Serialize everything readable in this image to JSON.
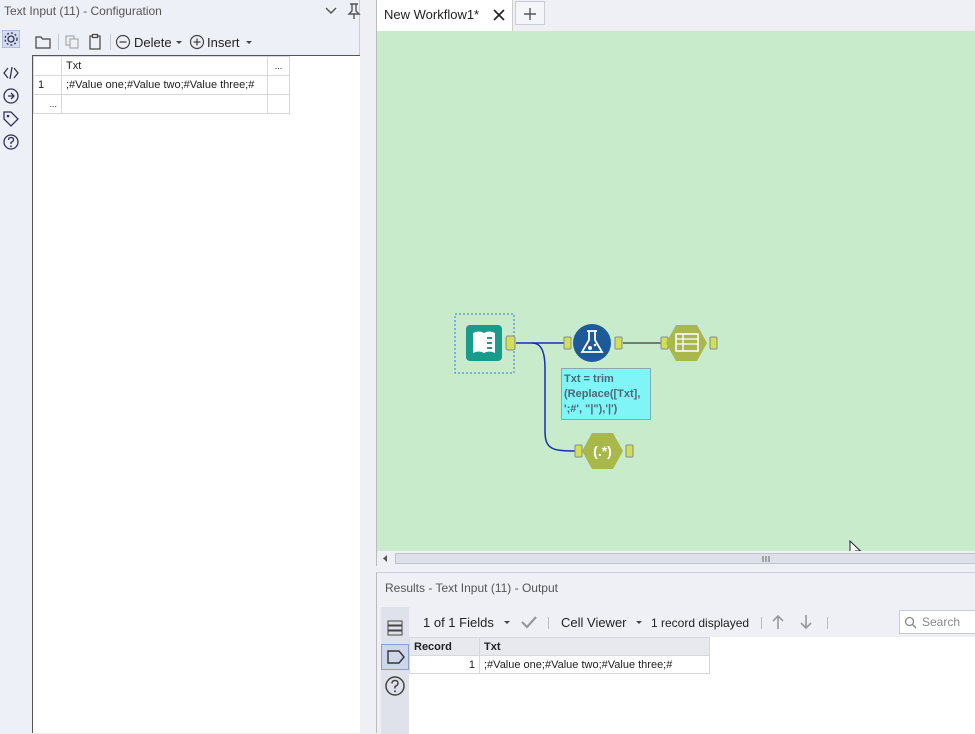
{
  "config_panel": {
    "title": "Text Input (11) - Configuration",
    "toolbar": {
      "delete_label": "Delete",
      "insert_label": "Insert"
    },
    "grid": {
      "column_header": "Txt",
      "more_header": "...",
      "rows": [
        {
          "num": "1",
          "value": ";#Value one;#Value two;#Value three;#"
        }
      ],
      "new_row_marker": "..."
    }
  },
  "tabs": [
    {
      "label": "New Workflow1*"
    }
  ],
  "canvas": {
    "formula_annotation": [
      "Txt = trim",
      "(Replace([Txt],",
      "';#', \"|\"),'|')"
    ],
    "regex_label": "(.*)"
  },
  "results": {
    "title": "Results - Text Input (11) - Output",
    "fields_selector": "1 of 1 Fields",
    "viewer_selector": "Cell Viewer",
    "record_count": "1 record displayed",
    "search_placeholder": "Search",
    "columns": [
      "Record",
      "Txt"
    ],
    "rows": [
      {
        "record": "1",
        "txt": ";#Value one;#Value two;#Value three;#"
      }
    ]
  },
  "colors": {
    "canvas_bg": "#c8ebcc",
    "input_tool": "#1a9a8a",
    "formula_tool": "#1d5a9a",
    "tool_olive": "#a9b84a",
    "connection": "#1a2eb0",
    "annotation_bg": "#7ff5f8"
  }
}
